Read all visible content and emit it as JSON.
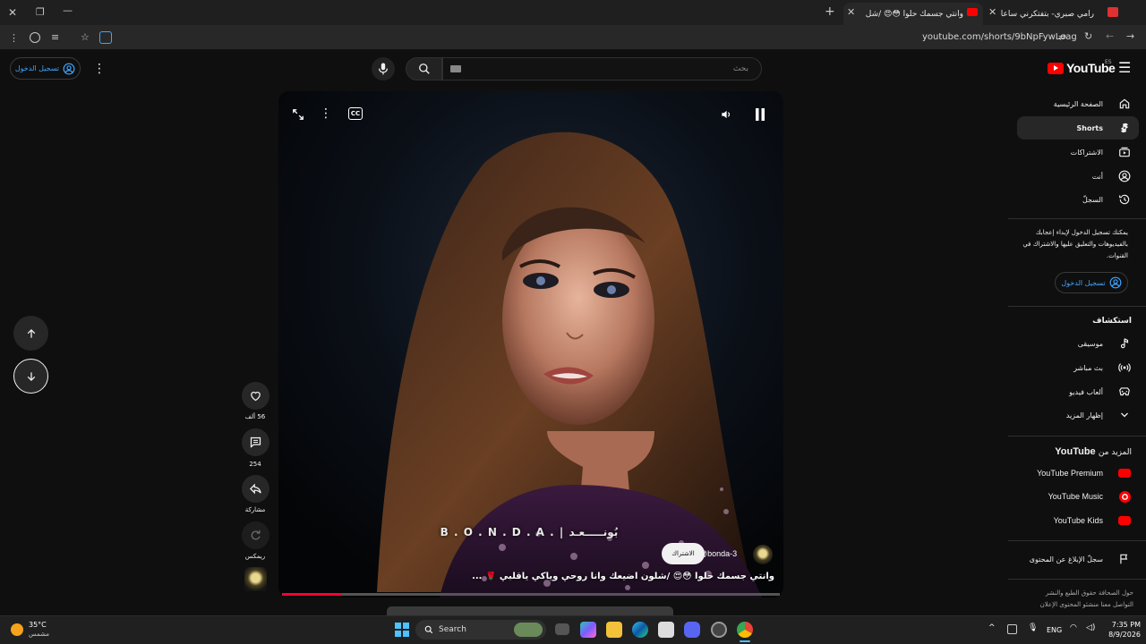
{
  "browser": {
    "tabs": [
      {
        "title": "رامي صبري- بتفتكرني ساعات oud",
        "active": false
      },
      {
        "title": "وانتي جسمك حلوا 😳😍 /شل",
        "active": true
      }
    ],
    "new_tab_label": "+",
    "url": "youtube.com/shorts/9bNpFywLoag"
  },
  "header": {
    "sign_in_label": "تسجيل الدخول",
    "search_placeholder": "بحث",
    "logo_text": "YouTube",
    "logo_country": "ES"
  },
  "sidebar": {
    "nav": [
      {
        "label": "الصفحة الرئيسية",
        "icon": "home-icon"
      },
      {
        "label": "Shorts",
        "icon": "shorts-icon",
        "active": true
      },
      {
        "label": "الاشتراكات",
        "icon": "subscriptions-icon"
      },
      {
        "label": "أنت",
        "icon": "you-icon"
      },
      {
        "label": "السجلّ",
        "icon": "history-icon"
      }
    ],
    "signin_prompt": "يمكنك تسجيل الدخول لإبداء إعجابك بالفيديوهات والتعليق عليها والاشتراك في القنوات.",
    "signin_button": "تسجيل الدخول",
    "explore_heading": "استكشاف",
    "explore": [
      {
        "label": "موسيقى",
        "icon": "music-icon"
      },
      {
        "label": "بث مباشر",
        "icon": "live-icon"
      },
      {
        "label": "ألعاب فيديو",
        "icon": "gaming-icon"
      },
      {
        "label": "إظهار المزيد",
        "icon": "chevron-down-icon"
      }
    ],
    "more_heading_prefix": "المزيد من",
    "more_heading_brand": "YouTube",
    "more": [
      {
        "label": "YouTube Premium"
      },
      {
        "label": "YouTube Music"
      },
      {
        "label": "YouTube Kids"
      }
    ],
    "report_label": "سجلّ الإبلاغ عن المحتوى",
    "footer_line1": "حول  الصحافة  حقوق الطبع والنشر",
    "footer_line2": "التواصل معنا  منشئو المحتوى  الإعلان"
  },
  "short": {
    "channel": "@bonda-3",
    "subscribe_label": "الاشتراك",
    "caption": "وانتي جسمك حلوا 😳😍 /شلون اضيعك وانا روحي وياكي ياقلبي 🌹 ...",
    "watermark": "B . O . N . D . A . | بُونـــــعـد",
    "progress": 0.12
  },
  "actions": {
    "likes": "56 ألف",
    "comments": "254",
    "share": "مشاركة",
    "remix": "ريمكس"
  },
  "taskbar": {
    "weather_temp": "35°C",
    "weather_desc": "مشمس",
    "search_label": "Search",
    "lang": "ENG",
    "time": "7:35 PM",
    "date": "8/9/2026"
  },
  "colors": {
    "accent_red": "#ff0000",
    "link_blue": "#3ea6ff",
    "background": "#0f0f0f"
  }
}
